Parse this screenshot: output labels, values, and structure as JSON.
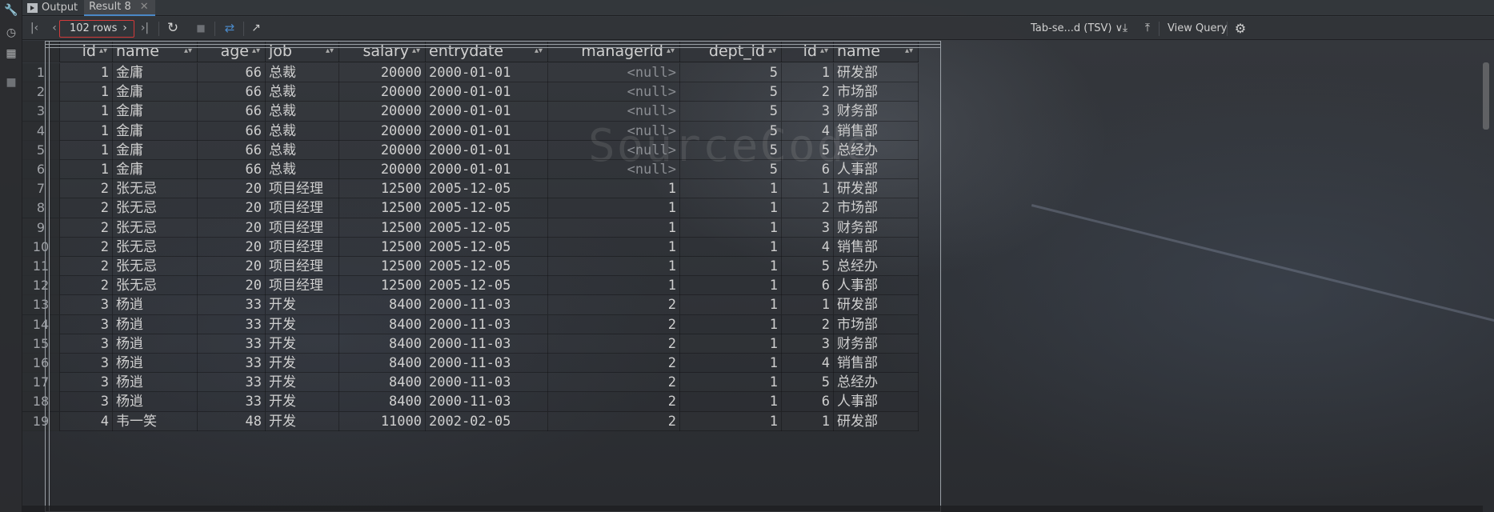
{
  "tabs": [
    {
      "label": "Output",
      "icon": "play-output-icon"
    },
    {
      "label": "Result 8",
      "icon": "table-grid-icon",
      "active": true
    }
  ],
  "toolbar": {
    "rows_label": "102 rows",
    "export_format": "Tab-se...d (TSV)",
    "view_query_label": "View Query"
  },
  "columns": [
    "id",
    "name",
    "age",
    "job",
    "salary",
    "entrydate",
    "managerid",
    "dept_id",
    "id",
    "name"
  ],
  "null_text": "<null>",
  "rows": [
    [
      "1",
      "1",
      "金庸",
      "66",
      "总裁",
      "20000",
      "2000-01-01",
      "<null>",
      "5",
      "1",
      "研发部"
    ],
    [
      "2",
      "1",
      "金庸",
      "66",
      "总裁",
      "20000",
      "2000-01-01",
      "<null>",
      "5",
      "2",
      "市场部"
    ],
    [
      "3",
      "1",
      "金庸",
      "66",
      "总裁",
      "20000",
      "2000-01-01",
      "<null>",
      "5",
      "3",
      "财务部"
    ],
    [
      "4",
      "1",
      "金庸",
      "66",
      "总裁",
      "20000",
      "2000-01-01",
      "<null>",
      "5",
      "4",
      "销售部"
    ],
    [
      "5",
      "1",
      "金庸",
      "66",
      "总裁",
      "20000",
      "2000-01-01",
      "<null>",
      "5",
      "5",
      "总经办"
    ],
    [
      "6",
      "1",
      "金庸",
      "66",
      "总裁",
      "20000",
      "2000-01-01",
      "<null>",
      "5",
      "6",
      "人事部"
    ],
    [
      "7",
      "2",
      "张无忌",
      "20",
      "项目经理",
      "12500",
      "2005-12-05",
      "1",
      "1",
      "1",
      "研发部"
    ],
    [
      "8",
      "2",
      "张无忌",
      "20",
      "项目经理",
      "12500",
      "2005-12-05",
      "1",
      "1",
      "2",
      "市场部"
    ],
    [
      "9",
      "2",
      "张无忌",
      "20",
      "项目经理",
      "12500",
      "2005-12-05",
      "1",
      "1",
      "3",
      "财务部"
    ],
    [
      "10",
      "2",
      "张无忌",
      "20",
      "项目经理",
      "12500",
      "2005-12-05",
      "1",
      "1",
      "4",
      "销售部"
    ],
    [
      "11",
      "2",
      "张无忌",
      "20",
      "项目经理",
      "12500",
      "2005-12-05",
      "1",
      "1",
      "5",
      "总经办"
    ],
    [
      "12",
      "2",
      "张无忌",
      "20",
      "项目经理",
      "12500",
      "2005-12-05",
      "1",
      "1",
      "6",
      "人事部"
    ],
    [
      "13",
      "3",
      "杨逍",
      "33",
      "开发",
      "8400",
      "2000-11-03",
      "2",
      "1",
      "1",
      "研发部"
    ],
    [
      "14",
      "3",
      "杨逍",
      "33",
      "开发",
      "8400",
      "2000-11-03",
      "2",
      "1",
      "2",
      "市场部"
    ],
    [
      "15",
      "3",
      "杨逍",
      "33",
      "开发",
      "8400",
      "2000-11-03",
      "2",
      "1",
      "3",
      "财务部"
    ],
    [
      "16",
      "3",
      "杨逍",
      "33",
      "开发",
      "8400",
      "2000-11-03",
      "2",
      "1",
      "4",
      "销售部"
    ],
    [
      "17",
      "3",
      "杨逍",
      "33",
      "开发",
      "8400",
      "2000-11-03",
      "2",
      "1",
      "5",
      "总经办"
    ],
    [
      "18",
      "3",
      "杨逍",
      "33",
      "开发",
      "8400",
      "2000-11-03",
      "2",
      "1",
      "6",
      "人事部"
    ],
    [
      "19",
      "4",
      "韦一笑",
      "48",
      "开发",
      "11000",
      "2002-02-05",
      "2",
      "1",
      "1",
      "研发部"
    ]
  ],
  "background_text": "SourceCode",
  "colors": {
    "accent": "#4a88c7",
    "highlight_border": "#d23a3a",
    "null_text": "#8a8d92"
  }
}
